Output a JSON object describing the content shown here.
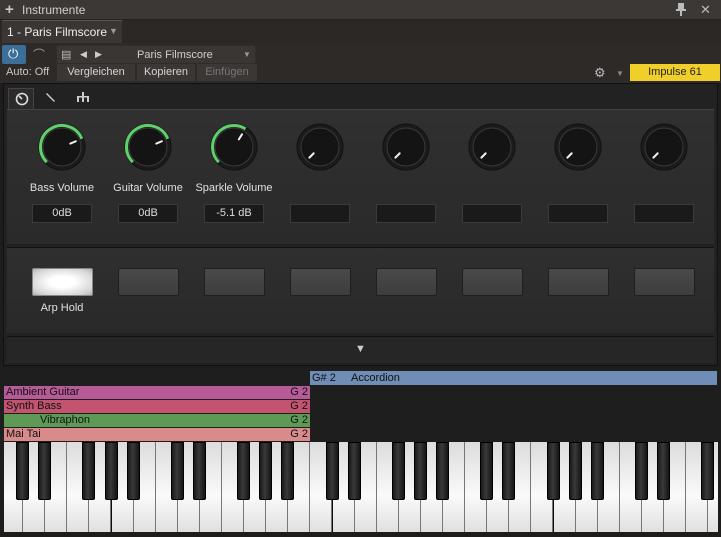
{
  "window": {
    "title": "Instrumente"
  },
  "tab": {
    "label": "1 - Paris Filmscore"
  },
  "toolbar": {
    "preset_name": "Paris Filmscore",
    "auto_label": "Auto: Off",
    "compare_label": "Vergleichen",
    "copy_label": "Kopieren",
    "paste_label": "Einfügen",
    "device_label": "Impulse 61"
  },
  "colors": {
    "accent_blue": "#3b6e98",
    "device_yellow": "#f1cf2a",
    "knob_arc_green": "#5fd06a",
    "accordion_blue": "#6f8db5"
  },
  "knobs": [
    {
      "label": "Bass Volume",
      "value": "0dB",
      "level": 0.75
    },
    {
      "label": "Guitar Volume",
      "value": "0dB",
      "level": 0.75
    },
    {
      "label": "Sparkle Volume",
      "value": "-5.1 dB",
      "level": 0.62
    },
    {
      "label": "",
      "value": "",
      "level": 0
    },
    {
      "label": "",
      "value": "",
      "level": 0
    },
    {
      "label": "",
      "value": "",
      "level": 0
    },
    {
      "label": "",
      "value": "",
      "level": 0
    },
    {
      "label": "",
      "value": "",
      "level": 0
    }
  ],
  "pads": [
    {
      "label": "Arp Hold",
      "on": true
    },
    {
      "label": "",
      "on": false
    },
    {
      "label": "",
      "on": false
    },
    {
      "label": "",
      "on": false
    },
    {
      "label": "",
      "on": false
    },
    {
      "label": "",
      "on": false
    },
    {
      "label": "",
      "on": false
    },
    {
      "label": "",
      "on": false
    }
  ],
  "key_split": {
    "note": "G# 2",
    "name": "Accordion",
    "color": "#6f8db5"
  },
  "layers": [
    {
      "name": "Ambient Guitar",
      "note": "G 2",
      "color": "#b75a98"
    },
    {
      "name": "Synth Bass",
      "note": "G 2",
      "color": "#c25470"
    },
    {
      "name": "Vibraphon",
      "note": "G 2",
      "color": "#5d9a55"
    },
    {
      "name": "Mai Tai",
      "note": "G 2",
      "color": "#d98a8a"
    }
  ]
}
